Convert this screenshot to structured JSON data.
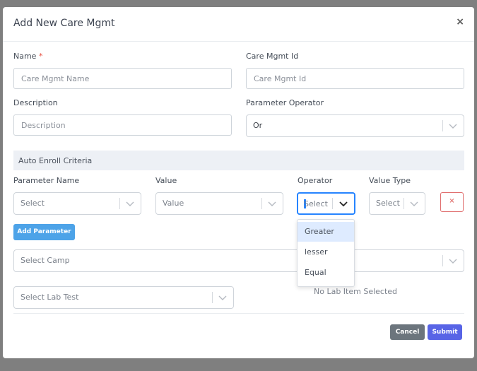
{
  "modal": {
    "title": "Add New Care Mgmt",
    "close_glyph": "×"
  },
  "form": {
    "name": {
      "label": "Name",
      "required_mark": "*",
      "placeholder": "Care Mgmt Name"
    },
    "care_mgmt_id": {
      "label": "Care Mgmt Id",
      "placeholder": "Care Mgmt Id"
    },
    "description": {
      "label": "Description",
      "placeholder": "Description"
    },
    "parameter_operator": {
      "label": "Parameter Operator",
      "value": "Or"
    }
  },
  "auto_enroll": {
    "section_title": "Auto Enroll Criteria",
    "columns": {
      "parameter_name": "Parameter Name",
      "value": "Value",
      "operator": "Operator",
      "value_type": "Value Type"
    },
    "row": {
      "parameter_name_placeholder": "Select",
      "value_placeholder": "Value",
      "operator_placeholder": "Select",
      "value_type_placeholder": "Select",
      "remove_glyph": "×"
    },
    "operator_options": [
      "Greater",
      "lesser",
      "Equal"
    ],
    "operator_highlighted": "Greater",
    "add_parameter_label": "Add Parameter"
  },
  "camp": {
    "placeholder": "Select Camp"
  },
  "lab": {
    "placeholder": "Select Lab Test",
    "empty_text": "No Lab Item Selected"
  },
  "footer": {
    "cancel_label": "Cancel",
    "submit_label": "Submit"
  },
  "colors": {
    "overlay": "#7f7f7f",
    "primary": "#5864e6",
    "add_button": "#4da3e8",
    "cancel_button": "#6c757d",
    "danger": "#d9534f",
    "focus_border": "#2684ff"
  },
  "icons": [
    "close-icon",
    "chevron-down-icon"
  ]
}
